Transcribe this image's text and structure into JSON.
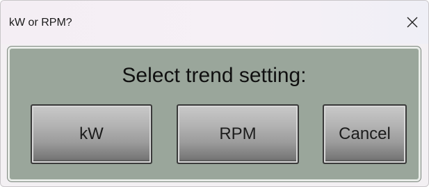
{
  "window": {
    "title": "kW or RPM?",
    "close_icon": "close-icon"
  },
  "dialog": {
    "prompt": "Select trend setting:",
    "buttons": {
      "kw": "kW",
      "rpm": "RPM",
      "cancel": "Cancel"
    }
  },
  "colors": {
    "panel_background": "#9aa69b",
    "button_face": "#b3b3b3",
    "titlebar": "#f4eef4"
  }
}
